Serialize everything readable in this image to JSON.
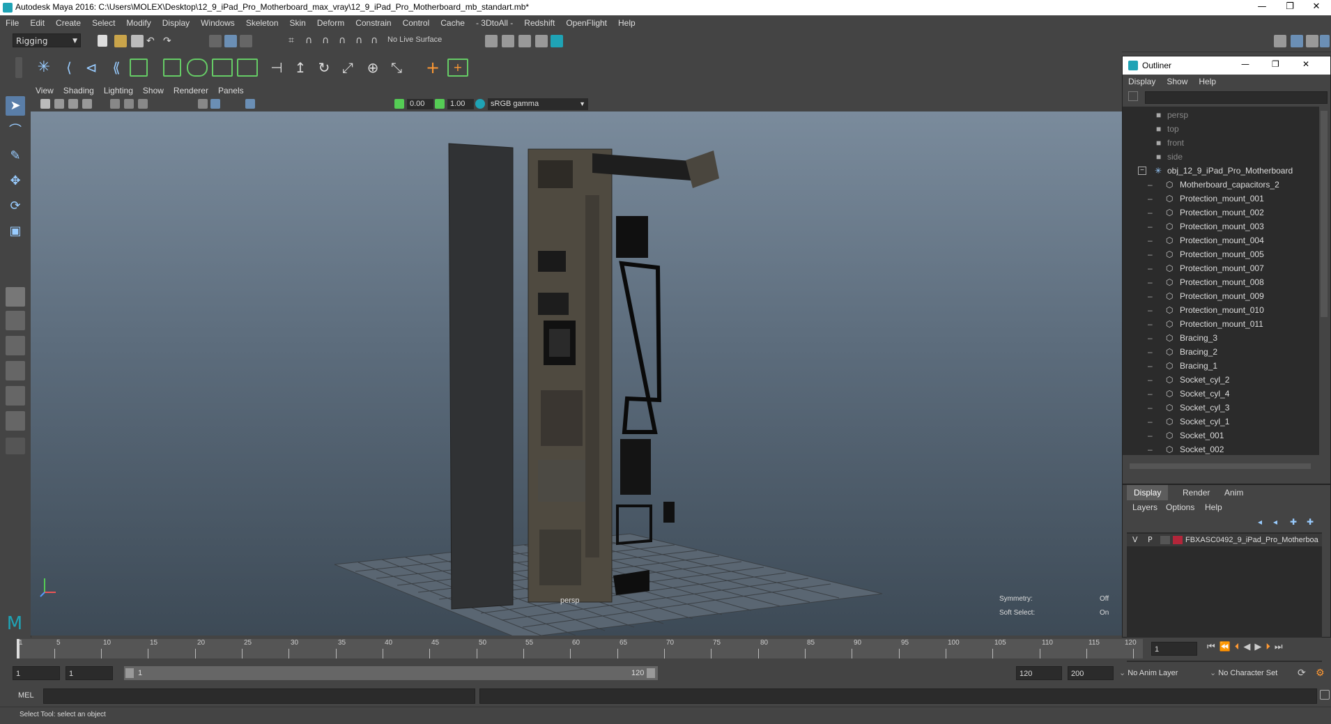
{
  "window": {
    "title": "Autodesk Maya 2016: C:\\Users\\MOLEX\\Desktop\\12_9_iPad_Pro_Motherboard_max_vray\\12_9_iPad_Pro_Motherboard_mb_standart.mb*",
    "minimize": "—",
    "restore": "❐",
    "close": "✕"
  },
  "main_menu": [
    "File",
    "Edit",
    "Create",
    "Select",
    "Modify",
    "Display",
    "Windows",
    "Skeleton",
    "Skin",
    "Deform",
    "Constrain",
    "Control",
    "Cache",
    "- 3DtoAll -",
    "Redshift",
    "OpenFlight",
    "Help"
  ],
  "status_line": {
    "mode": "Rigging",
    "live_surface": "No Live Surface"
  },
  "viewport": {
    "menu": [
      "View",
      "Shading",
      "Lighting",
      "Show",
      "Renderer",
      "Panels"
    ],
    "exposure": "0.00",
    "gamma": "1.00",
    "color_space": "sRGB gamma",
    "camera_label": "persp",
    "symmetry_label": "Symmetry:",
    "symmetry_value": "Off",
    "soft_select_label": "Soft Select:",
    "soft_select_value": "On"
  },
  "outliner": {
    "title": "Outliner",
    "menu": [
      "Display",
      "Show",
      "Help"
    ],
    "cameras": [
      "persp",
      "top",
      "front",
      "side"
    ],
    "group": "obj_12_9_iPad_Pro_Motherboard",
    "collapse_glyph": "−",
    "children": [
      "Motherboard_capacitors_2",
      "Protection_mount_001",
      "Protection_mount_002",
      "Protection_mount_003",
      "Protection_mount_004",
      "Protection_mount_005",
      "Protection_mount_007",
      "Protection_mount_008",
      "Protection_mount_009",
      "Protection_mount_010",
      "Protection_mount_011",
      "Bracing_3",
      "Bracing_2",
      "Bracing_1",
      "Socket_cyl_2",
      "Socket_cyl_4",
      "Socket_cyl_3",
      "Socket_cyl_1",
      "Socket_001",
      "Socket_002"
    ]
  },
  "layer_editor": {
    "tabs": [
      "Display",
      "Render",
      "Anim"
    ],
    "menu": [
      "Layers",
      "Options",
      "Help"
    ],
    "layer": {
      "visible": "V",
      "playback": "P",
      "name": "FBXASC0492_9_iPad_Pro_Motherboa",
      "color": "#b3263a"
    }
  },
  "time_slider": {
    "ticks": [
      "1",
      "5",
      "10",
      "15",
      "20",
      "25",
      "30",
      "35",
      "40",
      "45",
      "50",
      "55",
      "60",
      "65",
      "70",
      "75",
      "80",
      "85",
      "90",
      "95",
      "100",
      "105",
      "110",
      "115",
      "120"
    ],
    "current_frame": "1"
  },
  "range_slider": {
    "start": "1",
    "playback_start": "1",
    "range_start_label": "1",
    "range_end_label": "120",
    "playback_end": "120",
    "end": "200",
    "anim_layer": "No Anim Layer",
    "character_set": "No Character Set"
  },
  "command_line": {
    "language": "MEL"
  },
  "help_line": {
    "text": "Select Tool: select an object"
  },
  "colors": {
    "accent": "#1fa3b5",
    "panel": "#444444",
    "field": "#2b2b2b",
    "layer_red": "#b3263a"
  }
}
